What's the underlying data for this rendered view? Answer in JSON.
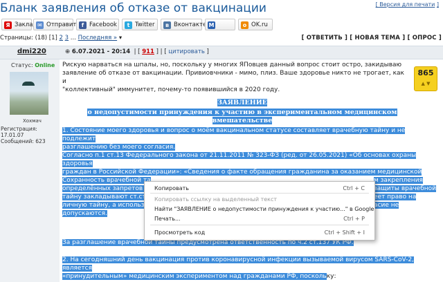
{
  "page": {
    "title": "Бланк заявления об отказе от вакцинации",
    "top_link_left": "[ Версия для печати",
    "top_link_right": "]"
  },
  "share": [
    {
      "label": "Закладки",
      "icon": "Я",
      "color": "#d00"
    },
    {
      "label": "Отправить",
      "icon": "✉",
      "color": "#5b8bd0"
    },
    {
      "label": "Facebook",
      "icon": "f",
      "color": "#3b5998"
    },
    {
      "label": "Twitter",
      "icon": "t",
      "color": "#29a9e0"
    },
    {
      "label": "Вконтакте",
      "icon": "в",
      "color": "#4c75a3"
    },
    {
      "label": "",
      "icon": "М",
      "color": "#2a60b0"
    },
    {
      "label": "OK.ru",
      "icon": "о",
      "color": "#f08a00"
    }
  ],
  "pager": {
    "label": "Страницы: (18)",
    "current": "[1]",
    "p2": "2",
    "p3": "3",
    "dots": "...",
    "last": "Последняя »",
    "actions": "[ ОТВЕТИТЬ ] [ НОВАЯ ТЕМА ] [ ОПРОС ]"
  },
  "post": {
    "author": "dmi220",
    "datetime": "6.07.2021 - 20:14",
    "number": "911",
    "quote": "цитировать",
    "status_label": "Статус:",
    "status_value": "Online",
    "nick": "Хохмач",
    "reg": "Регистрация: 17.01.07",
    "msgs": "Сообщений: 623",
    "rating": "865",
    "body": [
      "Рискую нарваться на шпалы, но, поскольку у многих ЯПовцев данный вопрос стоит остро, закидываю",
      "заявление об отказе от вакцинации. Привиовчники - мимо, плиз. Ваше здоровье никто не трогает, как и",
      "\"коллективный\" иммунитет, почему-то появившийся в 2020 году."
    ],
    "heading1": "ЗАЯВЛЕНИЕ",
    "heading2": "о недопустимости принуждения к участию в экспериментальном медицинском вмешательстве",
    "item1": [
      "1. Состояние моего здоровья и вопрос о моём вакцинальном статусе составляет врачебную тайну и не подлежит",
      "разглашению без моего согласия.",
      "Согласно п.1 ст.13 Федерального закона от 21.11.2011 № 323-ФЗ (ред. от 26.05.2021) «Об основах охраны здоровья",
      "граждан в Российской Федерации»: «Сведения о факте обращения гражданина за оказанием медицинской помощи,",
      "состоянии его здоровья и диагнозе, иные сведения, полученные при его медицинском обследовании и лечении,",
      "составляют врачебную та"
    ],
    "item1b": [
      "Сохранность врачебной та",
      "определённых запретов и",
      "тайну закладывают ст.ст.",
      "личную тайну, а использо",
      "допускаются."
    ],
    "item1b_right": [
      "м закрепления",
      "защиты врачебной",
      "еет право на",
      "асие не"
    ],
    "item1c": "За разглашение врачебной тайны предусмотрена ответственность по ч.2 ст.137 УК РФ.",
    "item2": [
      "2. На сегодняшний день вакцинация против коронавирусной инфекции вызываемой вирусом SARS-CoV-2, является",
      "«принудительным» медицинским экспериментом над гражданами РФ, посколь"
    ],
    "item2_tail": "ку:"
  },
  "context_menu": [
    {
      "label": "Копировать",
      "shortcut": "Ctrl + C",
      "disabled": false
    },
    {
      "label": "Копировать ссылку на выделенный текст",
      "shortcut": "",
      "disabled": true
    },
    {
      "label": "Найти \"ЗАЯВЛЕНИЕ о недопустимости принуждения к участию...\" в Google",
      "shortcut": "",
      "disabled": false
    },
    {
      "label": "Печать...",
      "shortcut": "Ctrl + P",
      "disabled": false
    },
    {
      "label": "Просмотреть код",
      "shortcut": "Ctrl + Shift + I",
      "disabled": false
    }
  ]
}
